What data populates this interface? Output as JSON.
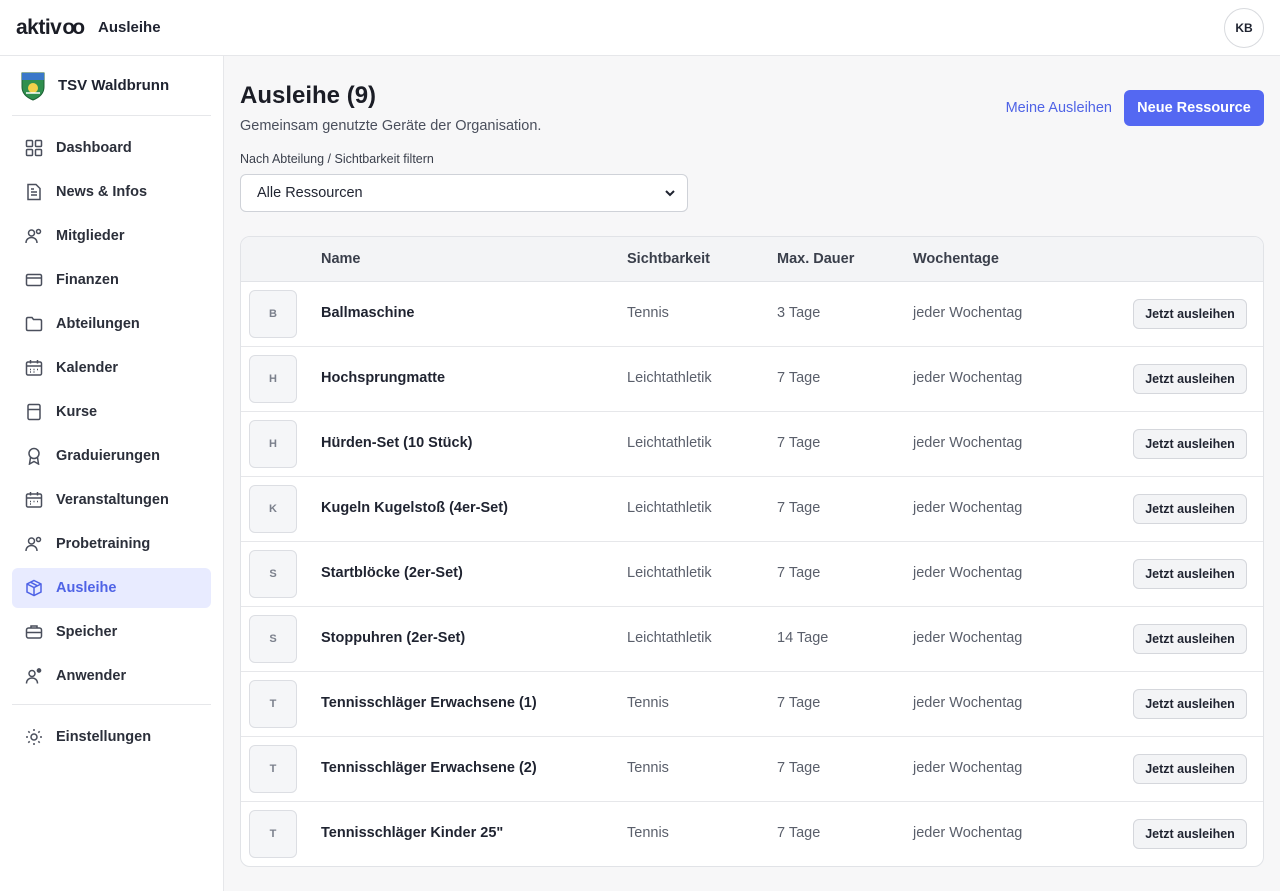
{
  "app": {
    "logo_text": "aktiv",
    "logo_mark": "oo",
    "page_label": "Ausleihe",
    "avatar_initials": "KB",
    "accent_color": "#5468f2"
  },
  "sidebar": {
    "org_name": "TSV Waldbrunn",
    "items": [
      {
        "label": "Dashboard",
        "icon": "grid-icon"
      },
      {
        "label": "News & Infos",
        "icon": "document-icon"
      },
      {
        "label": "Mitglieder",
        "icon": "users-icon"
      },
      {
        "label": "Finanzen",
        "icon": "wallet-icon"
      },
      {
        "label": "Abteilungen",
        "icon": "folder-icon"
      },
      {
        "label": "Kalender",
        "icon": "calendar-icon"
      },
      {
        "label": "Kurse",
        "icon": "book-icon"
      },
      {
        "label": "Graduierungen",
        "icon": "award-icon"
      },
      {
        "label": "Veranstaltungen",
        "icon": "calendar-event-icon"
      },
      {
        "label": "Probetraining",
        "icon": "users-trial-icon"
      },
      {
        "label": "Ausleihe",
        "icon": "box-icon",
        "active": true
      },
      {
        "label": "Speicher",
        "icon": "storage-icon"
      },
      {
        "label": "Anwender",
        "icon": "user-settings-icon"
      }
    ],
    "settings_label": "Einstellungen"
  },
  "header": {
    "title": "Ausleihe (9)",
    "subtitle": "Gemeinsam genutzte Geräte der Organisation.",
    "my_loans_label": "Meine Ausleihen",
    "new_resource_label": "Neue Ressource"
  },
  "filter": {
    "label": "Nach Abteilung / Sichtbarkeit filtern",
    "selected": "Alle Ressourcen"
  },
  "table": {
    "columns": [
      "Name",
      "Sichtbarkeit",
      "Max. Dauer",
      "Wochentage"
    ],
    "action_label": "Jetzt ausleihen",
    "rows": [
      {
        "initial": "B",
        "name": "Ballmaschine",
        "visibility": "Tennis",
        "duration": "3 Tage",
        "days": "jeder Wochentag"
      },
      {
        "initial": "H",
        "name": "Hochsprungmatte",
        "visibility": "Leichtathletik",
        "duration": "7 Tage",
        "days": "jeder Wochentag"
      },
      {
        "initial": "H",
        "name": "Hürden-Set (10 Stück)",
        "visibility": "Leichtathletik",
        "duration": "7 Tage",
        "days": "jeder Wochentag"
      },
      {
        "initial": "K",
        "name": "Kugeln Kugelstoß (4er-Set)",
        "visibility": "Leichtathletik",
        "duration": "7 Tage",
        "days": "jeder Wochentag"
      },
      {
        "initial": "S",
        "name": "Startblöcke (2er-Set)",
        "visibility": "Leichtathletik",
        "duration": "7 Tage",
        "days": "jeder Wochentag"
      },
      {
        "initial": "S",
        "name": "Stoppuhren (2er-Set)",
        "visibility": "Leichtathletik",
        "duration": "14 Tage",
        "days": "jeder Wochentag"
      },
      {
        "initial": "T",
        "name": "Tennisschläger Erwachsene (1)",
        "visibility": "Tennis",
        "duration": "7 Tage",
        "days": "jeder Wochentag"
      },
      {
        "initial": "T",
        "name": "Tennisschläger Erwachsene (2)",
        "visibility": "Tennis",
        "duration": "7 Tage",
        "days": "jeder Wochentag"
      },
      {
        "initial": "T",
        "name": "Tennisschläger Kinder 25\"",
        "visibility": "Tennis",
        "duration": "7 Tage",
        "days": "jeder Wochentag"
      }
    ]
  }
}
